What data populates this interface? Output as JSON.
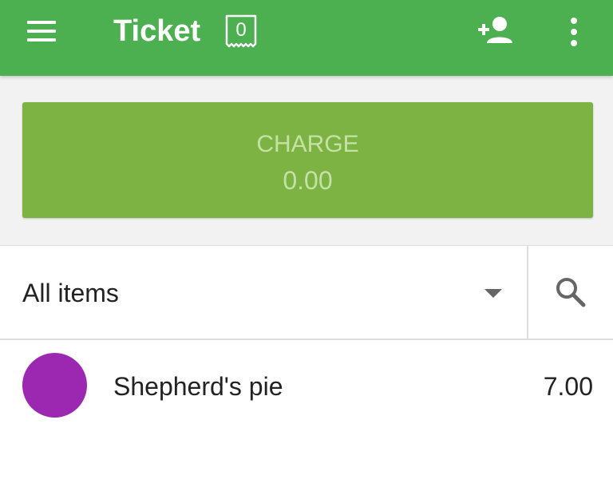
{
  "app_bar": {
    "title": "Ticket",
    "item_count": "0",
    "background_color": "#4caf50",
    "icons": [
      "menu-icon",
      "add-customer-icon",
      "more-vert-icon"
    ]
  },
  "charge_button": {
    "label": "CHARGE",
    "amount": "0.00",
    "color": "#7cb342"
  },
  "filter": {
    "selected_category": "All items",
    "icons": [
      "dropdown-arrow-icon",
      "search-icon"
    ]
  },
  "items": [
    {
      "name": "Shepherd's pie",
      "price": "7.00",
      "color": "#9c27b0"
    }
  ]
}
